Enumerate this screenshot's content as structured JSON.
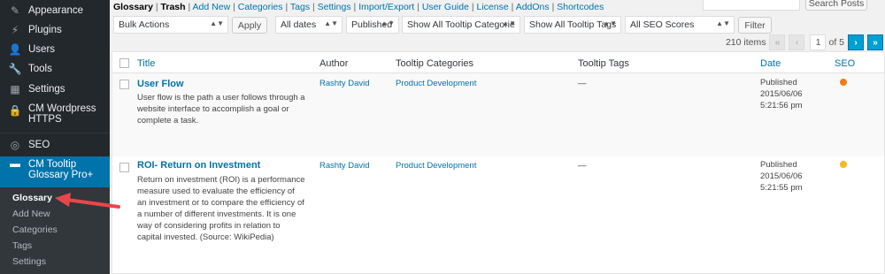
{
  "sidebar": {
    "items": [
      {
        "label": "Appearance",
        "icon": "paintbrush-icon"
      },
      {
        "label": "Plugins",
        "icon": "plug-icon"
      },
      {
        "label": "Users",
        "icon": "user-icon"
      },
      {
        "label": "Tools",
        "icon": "wrench-icon"
      },
      {
        "label": "Settings",
        "icon": "settings-icon"
      },
      {
        "label": "CM Wordpress HTTPS",
        "icon": "lock-icon"
      },
      {
        "label": "SEO",
        "icon": "seo-icon"
      },
      {
        "label": "CM Tooltip Glossary Pro+",
        "icon": "tooltip-icon"
      }
    ],
    "submenu": [
      "Glossary",
      "Add New",
      "Categories",
      "Tags",
      "Settings"
    ]
  },
  "subnav": {
    "items": [
      "Glossary",
      "Trash",
      "Add New",
      "Categories",
      "Tags",
      "Settings",
      "Import/Export",
      "User Guide",
      "License",
      "AddOns",
      "Shortcodes"
    ],
    "separator": "|"
  },
  "search": {
    "button": "Search Posts",
    "value": ""
  },
  "filters": {
    "bulk": "Bulk Actions",
    "apply": "Apply",
    "dates": "All dates",
    "status": "Published",
    "categories": "Show All Tooltip Categorie",
    "tags": "Show All Tooltip Tags",
    "seo": "All SEO Scores",
    "filter": "Filter"
  },
  "pagination": {
    "items": "210 items",
    "first": "«",
    "prev": "‹",
    "page": "1",
    "of": "of 5",
    "next": "›",
    "last": "»"
  },
  "table": {
    "headers": {
      "title": "Title",
      "author": "Author",
      "categories": "Tooltip Categories",
      "tags": "Tooltip Tags",
      "date": "Date",
      "seo": "SEO"
    },
    "rows": [
      {
        "title": "User Flow",
        "desc": "User flow is the path a user follows through a website interface to accomplish a goal or complete a task.",
        "author": "Rashty David",
        "category": "Product Development",
        "tags": "—",
        "status": "Published",
        "date": "2015/06/06",
        "time": "5:21:56 pm",
        "seo_color": "#ee7c1b"
      },
      {
        "title": "ROI- Return on Investment",
        "desc": "Return on investment (ROI) is a performance measure used to evaluate the efficiency of an investment or to compare the efficiency of a number of different investments. It is one way of considering profits in relation to capital invested. (Source: WikiPedia)",
        "author": "Rashty David",
        "category": "Product Development",
        "tags": "—",
        "status": "Published",
        "date": "2015/06/06",
        "time": "5:21:55 pm",
        "seo_color": "#f5b91f"
      }
    ]
  },
  "colors": {
    "sidebar": "#23282d",
    "accent": "#0073aa",
    "link": "#0073aa",
    "arrow": "#e8474a"
  }
}
